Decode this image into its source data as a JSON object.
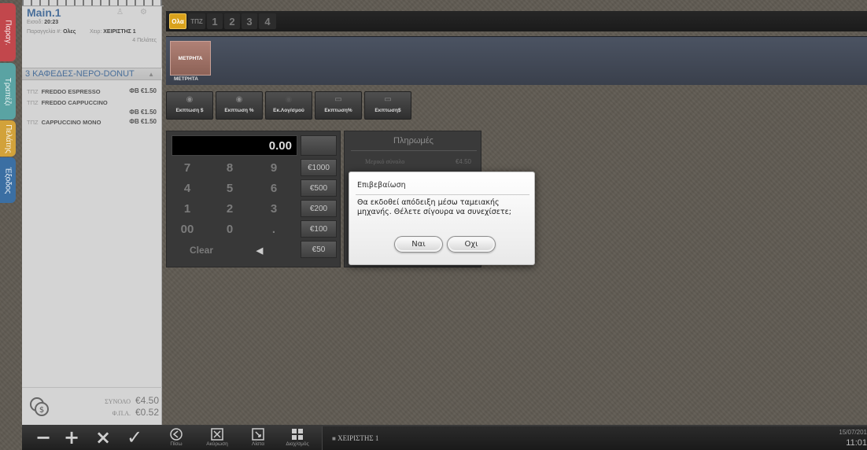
{
  "side_tabs": [
    {
      "label": "Παραγ.",
      "color": "#c2474c"
    },
    {
      "label": "Τραπέζι",
      "color": "#5aa3a3"
    },
    {
      "label": "Πελάτης",
      "color": "#d2a23a"
    },
    {
      "label": "Έξοδος",
      "color": "#3b6fa3"
    }
  ],
  "receipt": {
    "title": "Main.1",
    "entry_label": "Εισοδ:",
    "entry_time": "20:23",
    "order_label": "Παραγγελία #:",
    "order_value": "Ολες",
    "operator_label": "Χειρ:",
    "operator_value": "ΧΕΙΡΙΣΤΗΣ 1",
    "customers": "4 Πελάτες",
    "section_title": "3 ΚΑΦΕΔΕΣ-ΝΕΡΟ-DONUT",
    "items": [
      {
        "prefix": "ΤΠΖ",
        "name": "FREDDO ESPRESSO",
        "price": "ΦΒ €1.50"
      },
      {
        "prefix": "ΤΠΖ",
        "name": "FREDDO CAPPUCCINO",
        "price": "ΦΒ €1.50"
      },
      {
        "prefix": "ΤΠΖ",
        "name": "CAPPUCCINO MONO",
        "price": "ΦΒ €1.50"
      }
    ],
    "total_label": "ΣΥΝΟΛΟ",
    "total_value": "€4.50",
    "vat_label": "Φ.Π.Α.",
    "vat_value": "€0.52"
  },
  "categories": {
    "all_label": "Ολα",
    "tpz_label": "ΤΠΖ",
    "numbers": [
      "1",
      "2",
      "3",
      "4"
    ]
  },
  "payment": {
    "method_label": "ΜΕΤΡΗΤΑ",
    "method_under": "ΜΕΤΡΗΤΑ"
  },
  "discounts": [
    "Εκπτωση $",
    "Εκπτωση %",
    "Εκ.Λογ/σμού",
    "Εκπτωση%",
    "Εκπτωση$"
  ],
  "keypad": {
    "display": "0.00",
    "keys": [
      "7",
      "8",
      "9",
      "4",
      "5",
      "6",
      "1",
      "2",
      "3",
      "00",
      "0",
      "."
    ],
    "clear_label": "Clear",
    "backspace": "◀",
    "money": [
      "€1000",
      "€500",
      "€200",
      "€100",
      "€50"
    ]
  },
  "payments_panel": {
    "title": "Πληρωμές",
    "subtotal_label": "Μερικό σύνολο",
    "subtotal_value": "€4.50"
  },
  "dialog": {
    "title": "Επιβεβαίωση",
    "message": "Θα εκδοθεί απόδειξη μέσω ταμειακής μηχανής. Θέλετε σίγουρα να συνεχίσετε;",
    "yes_label": "Ναι",
    "no_label": "Οχι"
  },
  "bottom_bar": {
    "minus": "−",
    "plus": "+",
    "times": "×",
    "check": "✓",
    "tools": [
      {
        "label": "Πίσω",
        "icon": "back-icon"
      },
      {
        "label": "Ακύρωση",
        "icon": "cancel-icon"
      },
      {
        "label": "Λίστα",
        "icon": "list-icon"
      },
      {
        "label": "Διαχ/σμός",
        "icon": "grid-icon"
      }
    ],
    "user": "ΧΕΙΡΙΣΤΗΣ 1",
    "date": "15/07/201",
    "time": "11:01"
  }
}
